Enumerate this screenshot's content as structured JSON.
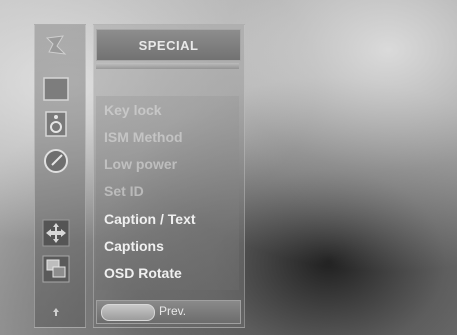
{
  "menu": {
    "title": "SPECIAL",
    "items": [
      {
        "label": "Key lock",
        "state": "dim"
      },
      {
        "label": "ISM Method",
        "state": "dim"
      },
      {
        "label": "Low power",
        "state": "dim"
      },
      {
        "label": "Set ID",
        "state": "dim"
      },
      {
        "label": "Caption / Text",
        "state": "active"
      },
      {
        "label": "Captions",
        "state": "active"
      },
      {
        "label": "OSD Rotate",
        "state": "active"
      }
    ]
  },
  "footer": {
    "prev_label": "Prev."
  },
  "sidebar": {
    "icons": [
      "picture-icon",
      "screen-icon",
      "audio-icon",
      "time-icon",
      "special-icon",
      "pip-icon",
      "up-arrow-icon"
    ]
  },
  "colors": {
    "active_text": "#f0f0f0",
    "dim_text": "#e1e1e1",
    "title_bar": "#7f7f7f"
  }
}
